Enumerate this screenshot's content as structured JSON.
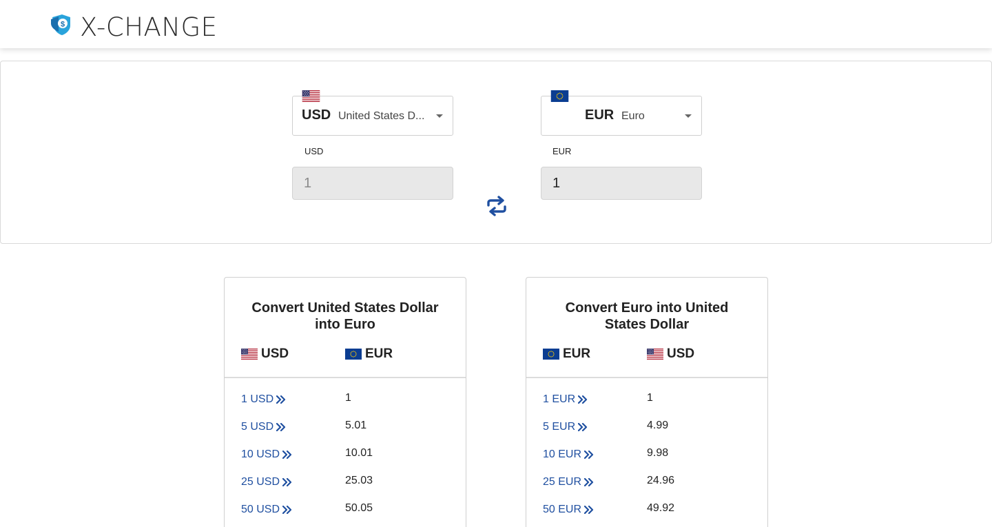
{
  "header": {
    "brand": "X-CHANGE",
    "logo_icon": "shield-dollar-icon"
  },
  "converter": {
    "from": {
      "code": "USD",
      "name": "United States D...",
      "amount_label": "USD",
      "amount_placeholder": "1"
    },
    "to": {
      "code": "EUR",
      "name": "Euro",
      "amount_label": "EUR",
      "amount_value": "1"
    },
    "swap_icon": "swap-arrows-icon"
  },
  "tables": [
    {
      "title": "Convert United States Dollar into Euro",
      "col_from": "USD",
      "col_to": "EUR",
      "rows": [
        {
          "label": "1 USD",
          "value": "1"
        },
        {
          "label": "5 USD",
          "value": "5.01"
        },
        {
          "label": "10 USD",
          "value": "10.01"
        },
        {
          "label": "25 USD",
          "value": "25.03"
        },
        {
          "label": "50 USD",
          "value": "50.05"
        }
      ]
    },
    {
      "title": "Convert Euro into United States Dollar",
      "col_from": "EUR",
      "col_to": "USD",
      "rows": [
        {
          "label": "1 EUR",
          "value": "1"
        },
        {
          "label": "5 EUR",
          "value": "4.99"
        },
        {
          "label": "10 EUR",
          "value": "9.98"
        },
        {
          "label": "25 EUR",
          "value": "24.96"
        },
        {
          "label": "50 EUR",
          "value": "49.92"
        }
      ]
    }
  ],
  "colors": {
    "accent": "#1f4fa0",
    "logo": "#29a3db"
  }
}
